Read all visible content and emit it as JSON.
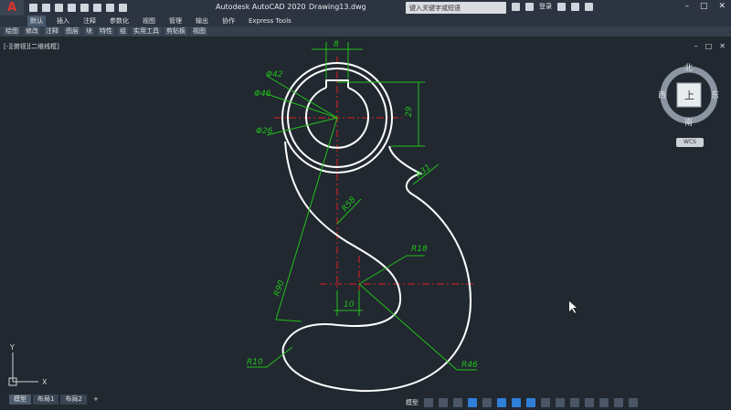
{
  "app": {
    "logo": "A",
    "title": "Autodesk AutoCAD 2020",
    "file": "Drawing13.dwg",
    "search_placeholder": "键入关键字或短语",
    "signin": "登录"
  },
  "ribbon_tabs": [
    "默认",
    "插入",
    "注释",
    "参数化",
    "视图",
    "管理",
    "输出",
    "协作",
    "Express Tools"
  ],
  "ribbon_panels": [
    "绘图",
    "修改",
    "注释",
    "图层",
    "块",
    "特性",
    "组",
    "实用工具",
    "剪贴板",
    "视图"
  ],
  "viewport_label": "[-][俯视][二维线框]",
  "viewcube": {
    "north": "北",
    "south": "南",
    "east": "东",
    "west": "西",
    "face": "上",
    "wcs": "WCS"
  },
  "dimensions": {
    "key_width": "8",
    "phi42": "Φ42",
    "phi46": "Φ46",
    "phi26": "Φ26",
    "dim29": "29",
    "r31": "R31",
    "r58": "R58",
    "r18": "R18",
    "r90": "R90",
    "dim10": "10",
    "r10": "R10",
    "r46": "R46"
  },
  "ucs": {
    "y": "Y",
    "x": "X"
  },
  "layout_tabs": [
    "模型",
    "布局1",
    "布局2"
  ],
  "status_model": "模型",
  "colors": {
    "dim": "#22c11a",
    "center": "#e02020",
    "outline": "#ffffff",
    "bg": "#212830"
  }
}
